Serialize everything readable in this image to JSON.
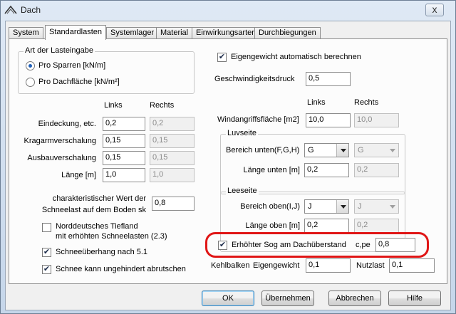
{
  "window": {
    "title": "Dach",
    "close_glyph": "x"
  },
  "tabs": [
    {
      "label": "System"
    },
    {
      "label": "Standardlasten"
    },
    {
      "label": "Systemlager"
    },
    {
      "label": "Material"
    },
    {
      "label": "Einwirkungsarten"
    },
    {
      "label": "Durchbiegungen"
    }
  ],
  "load_input": {
    "group_title": "Art der Lasteingabe",
    "options": [
      "Pro Sparren [kN/m]",
      "Pro Dachfläche [kN/m²]"
    ],
    "selected_index": 0
  },
  "loads": {
    "col_left": "Links",
    "col_right": "Rechts",
    "rows": [
      {
        "label": "Eindeckung, etc.",
        "left": "0,2",
        "right": "0,2"
      },
      {
        "label": "Kragarmverschalung",
        "left": "0,15",
        "right": "0,15"
      },
      {
        "label": "Ausbauverschalung",
        "left": "0,15",
        "right": "0,15"
      },
      {
        "label": "Länge [m]",
        "left": "1,0",
        "right": "1,0"
      }
    ]
  },
  "snow": {
    "char_label_1": "charakteristischer Wert der",
    "char_label_2": "Schneelast auf dem Boden sk",
    "char_value": "0,8",
    "lowland_label_1": "Norddeutsches Tiefland",
    "lowland_label_2": "mit erhöhten Schneelasten (2.3)",
    "lowland_checked": false,
    "overhang_label": "Schneeüberhang nach 5.1",
    "overhang_checked": true,
    "slide_label": "Schnee kann ungehindert abrutschen",
    "slide_checked": true
  },
  "right": {
    "selfweight_label": "Eigengewicht automatisch berechnen",
    "selfweight_checked": true,
    "speed_pressure_label": "Geschwindigkeitsdruck",
    "speed_pressure_value": "0,5",
    "col_left": "Links",
    "col_right": "Rechts",
    "wind_area_label": "Windangriffsfläche [m2]",
    "wind_area_left": "10,0",
    "wind_area_right": "10,0",
    "luv": {
      "title": "Luvseite",
      "range_label": "Bereich unten(F,G,H)",
      "range_left": "G",
      "range_right": "G",
      "length_label": "Länge unten [m]",
      "length_left": "0,2",
      "length_right": "0,2"
    },
    "lee": {
      "title": "Leeseite",
      "range_label": "Bereich oben(I,J)",
      "range_left": "J",
      "range_right": "J",
      "length_label": "Länge oben [m]",
      "length_left": "0,2",
      "length_right": "0,2"
    },
    "suction_label": "Erhöhter Sog am Dachüberstand",
    "suction_checked": true,
    "cpe_label": "c,pe",
    "cpe_value": "0,8",
    "highlight_color": "#e01616"
  },
  "kehlbalken": {
    "label": "Kehlbalken",
    "self_label": "Eigengewicht",
    "self_value": "0,1",
    "live_label": "Nutzlast",
    "live_value": "0,1"
  },
  "buttons": {
    "ok": "OK",
    "apply": "Übernehmen",
    "cancel": "Abbrechen",
    "help": "Hilfe"
  },
  "icons": {
    "app": "roof-icon",
    "close": "close-icon",
    "check": "checkmark-icon",
    "dropdown": "chevron-down-icon"
  }
}
